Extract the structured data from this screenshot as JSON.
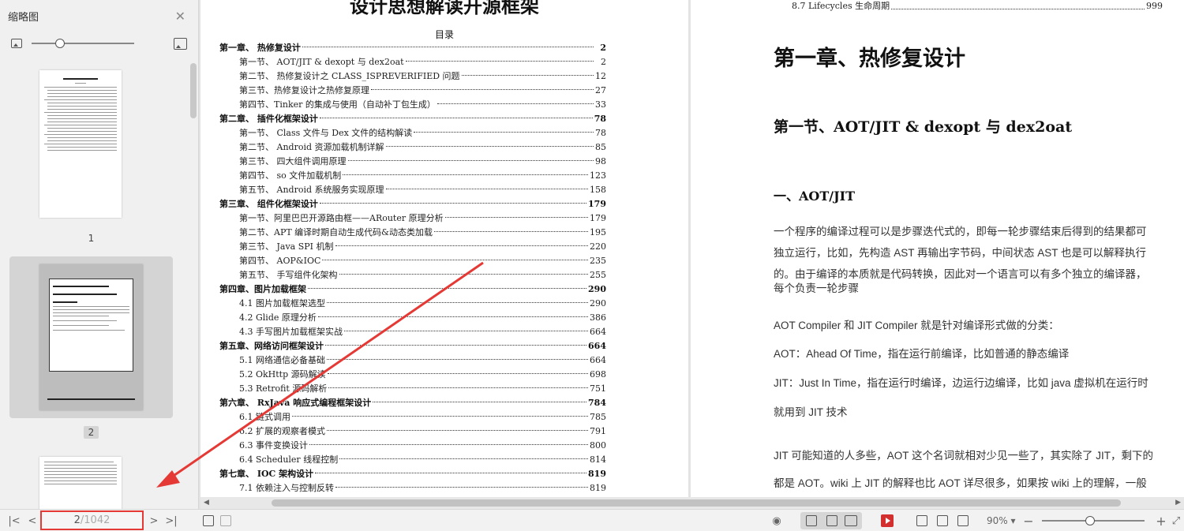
{
  "sidebar": {
    "title": "缩略图",
    "close_icon": "close-icon",
    "thumbs": [
      {
        "num": "1"
      },
      {
        "num": "2"
      },
      {
        "num": ""
      }
    ]
  },
  "left_page": {
    "doc_title": "设计思想解读开源框架",
    "toc_title": "目录",
    "toc": [
      {
        "type": "ch",
        "label": "第一章、 热修复设计",
        "page": "2"
      },
      {
        "type": "sec",
        "label": "第一节、 AOT/JIT & dexopt 与 dex2oat",
        "page": "2"
      },
      {
        "type": "sec",
        "label": "第二节、 热修复设计之 CLASS_ISPREVERIFIED 问题",
        "page": "12"
      },
      {
        "type": "sec",
        "label": "第三节、热修复设计之热修复原理",
        "page": "27"
      },
      {
        "type": "sec",
        "label": "第四节、Tinker 的集成与使用（自动补丁包生成）",
        "page": "33"
      },
      {
        "type": "ch",
        "label": "第二章、 插件化框架设计",
        "page": "78"
      },
      {
        "type": "sec",
        "label": "第一节、 Class 文件与 Dex 文件的结构解读",
        "page": "78"
      },
      {
        "type": "sec",
        "label": "第二节、 Android 资源加载机制详解",
        "page": "85"
      },
      {
        "type": "sec",
        "label": "第三节、 四大组件调用原理",
        "page": "98"
      },
      {
        "type": "sec",
        "label": "第四节、 so 文件加载机制",
        "page": "123"
      },
      {
        "type": "sec",
        "label": "第五节、 Android 系统服务实现原理",
        "page": "158"
      },
      {
        "type": "ch",
        "label": "第三章、 组件化框架设计",
        "page": "179"
      },
      {
        "type": "sec",
        "label": "第一节、阿里巴巴开源路由框——ARouter 原理分析",
        "page": "179"
      },
      {
        "type": "sec",
        "label": "第二节、APT 编译时期自动生成代码&动态类加载",
        "page": "195"
      },
      {
        "type": "sec",
        "label": "第三节、 Java SPI 机制",
        "page": "220"
      },
      {
        "type": "sec",
        "label": "第四节、 AOP&IOC",
        "page": "235"
      },
      {
        "type": "sec",
        "label": "第五节、 手写组件化架构",
        "page": "255"
      },
      {
        "type": "ch",
        "label": "第四章、图片加载框架",
        "page": "290"
      },
      {
        "type": "sec",
        "label": "4.1 图片加载框架选型",
        "page": "290"
      },
      {
        "type": "sec",
        "label": "4.2 Glide 原理分析",
        "page": "386"
      },
      {
        "type": "sec",
        "label": "4.3 手写图片加载框架实战",
        "page": "664"
      },
      {
        "type": "ch",
        "label": "第五章、网络访问框架设计",
        "page": "664"
      },
      {
        "type": "sec",
        "label": "5.1 网络通信必备基础",
        "page": "664"
      },
      {
        "type": "sec",
        "label": "5.2 OkHttp 源码解读",
        "page": "698"
      },
      {
        "type": "sec",
        "label": "5.3  Retrofit 源码解析",
        "page": "751"
      },
      {
        "type": "ch",
        "label": "第六章、 RxJava 响应式编程框架设计",
        "page": "784"
      },
      {
        "type": "sec",
        "label": "6.1  链式调用",
        "page": "785"
      },
      {
        "type": "sec",
        "label": "6.2  扩展的观察者模式",
        "page": "791"
      },
      {
        "type": "sec",
        "label": "6.3  事件变换设计",
        "page": "800"
      },
      {
        "type": "sec",
        "label": "6.4  Scheduler 线程控制",
        "page": "814"
      },
      {
        "type": "ch",
        "label": "第七章、 IOC 架构设计",
        "page": "819"
      },
      {
        "type": "sec",
        "label": "7.1  依赖注入与控制反转",
        "page": "819"
      }
    ]
  },
  "right_page": {
    "toc_line": {
      "label": "8.7  Lifecycles 生命周期",
      "page": "999"
    },
    "chapter_title": "第一章、热修复设计",
    "section_title": "第一节、AOT/JIT & dexopt 与 dex2oat",
    "sub_title": "一、AOT/JIT",
    "paragraphs": [
      "一个程序的编译过程可以是步骤迭代式的，即每一轮步骤结束后得到的结果都可",
      "独立运行，比如，先构造 AST 再输出字节码，中间状态 AST 也是可以解释执行",
      "的。由于编译的本质就是代码转换，因此对一个语言可以有多个独立的编译器，",
      "每个负责一轮步骤",
      "AOT Compiler 和 JIT Compiler 就是针对编译形式做的分类：",
      "AOT：Ahead Of Time，指在运行前编译，比如普通的静态编译",
      "JIT：Just In Time，指在运行时编译，边运行边编译，比如 java 虚拟机在运行时",
      "就用到 JIT 技术",
      "JIT 可能知道的人多些，AOT 这个名词就相对少见一些了，其实除了 JIT，剩下的",
      "都是 AOT。wiki 上 JIT 的解释也比 AOT 详尽很多，如果按 wiki 上的理解，一般"
    ]
  },
  "bottombar": {
    "current_page": "2",
    "total_pages": "/1042",
    "zoom": "90%"
  },
  "colors": {
    "annotation": "#e53935",
    "active_thumb": "#d4d4d4"
  }
}
